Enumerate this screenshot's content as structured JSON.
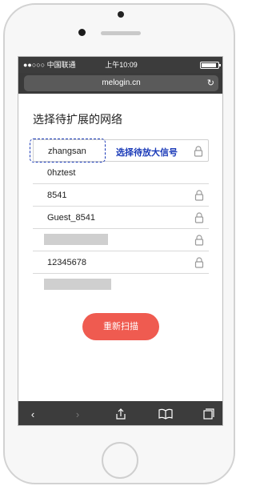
{
  "status_bar": {
    "carrier": "●●○○○ 中国联通",
    "time": "上午10:09"
  },
  "address_bar": {
    "url": "melogin.cn"
  },
  "page": {
    "title": "选择待扩展的网络",
    "networks": [
      {
        "label": "zhangsan",
        "locked": true
      },
      {
        "label": "0hztest",
        "locked": false
      },
      {
        "label": "8541",
        "locked": true
      },
      {
        "label": "Guest_8541",
        "locked": true
      },
      {
        "label": "",
        "locked": true
      },
      {
        "label": "12345678",
        "locked": true
      },
      {
        "label": "",
        "locked": false
      }
    ],
    "annotation": "选择待放大信号",
    "rescan_button": "重新扫描"
  },
  "toolbar": {
    "items": [
      "back-icon",
      "forward-icon",
      "share-icon",
      "bookmarks-icon",
      "tabs-icon"
    ]
  },
  "colors": {
    "accent": "#ef5b50",
    "annotation": "#1a3ab8",
    "bars": "#3c3c3c"
  }
}
